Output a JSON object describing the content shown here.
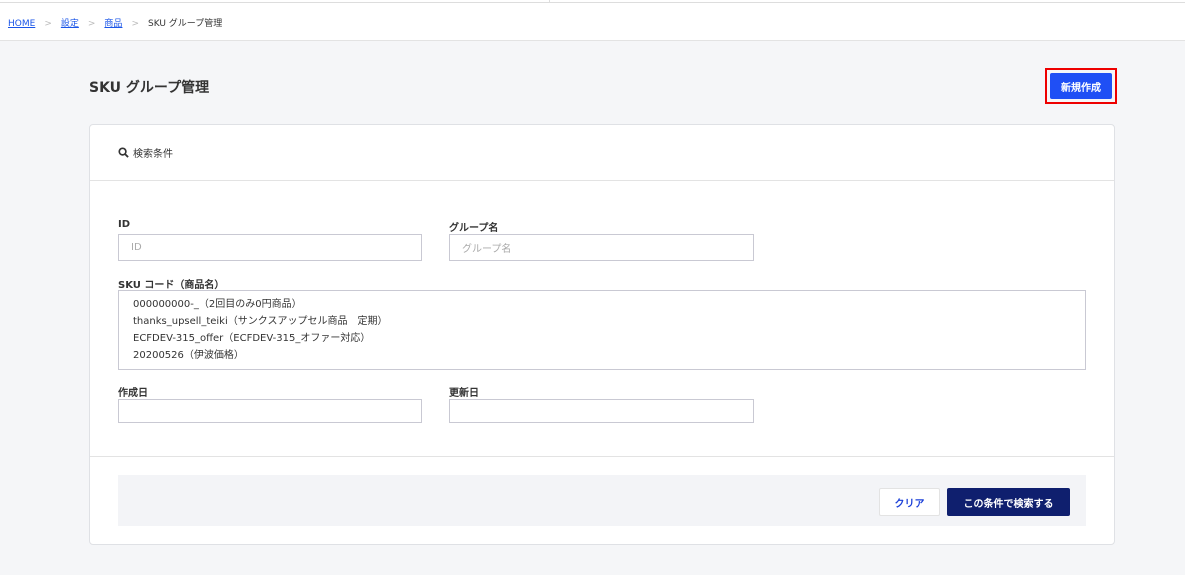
{
  "breadcrumb": [
    "HOME",
    "設定",
    "商品"
  ],
  "breadcrumb_current": "SKU グループ管理",
  "breadcrumb_sep": ">",
  "page_title": "SKU グループ管理",
  "new_button": "新規作成",
  "search_panel": {
    "title": "検索条件",
    "id_label": "ID",
    "id_placeholder": "ID",
    "group_label": "グループ名",
    "group_placeholder": "グループ名",
    "sku_label": "SKU コード（商品名）",
    "sku_options": [
      "000000000-_（2回目のみ0円商品）",
      "thanks_upsell_teiki（サンクスアップセル商品　定期）",
      "ECFDEV-315_offer（ECFDEV-315_オファー対応）",
      "20200526（伊波価格）"
    ],
    "created_label": "作成日",
    "updated_label": "更新日",
    "clear_button": "クリア",
    "search_button": "この条件で検索する"
  }
}
